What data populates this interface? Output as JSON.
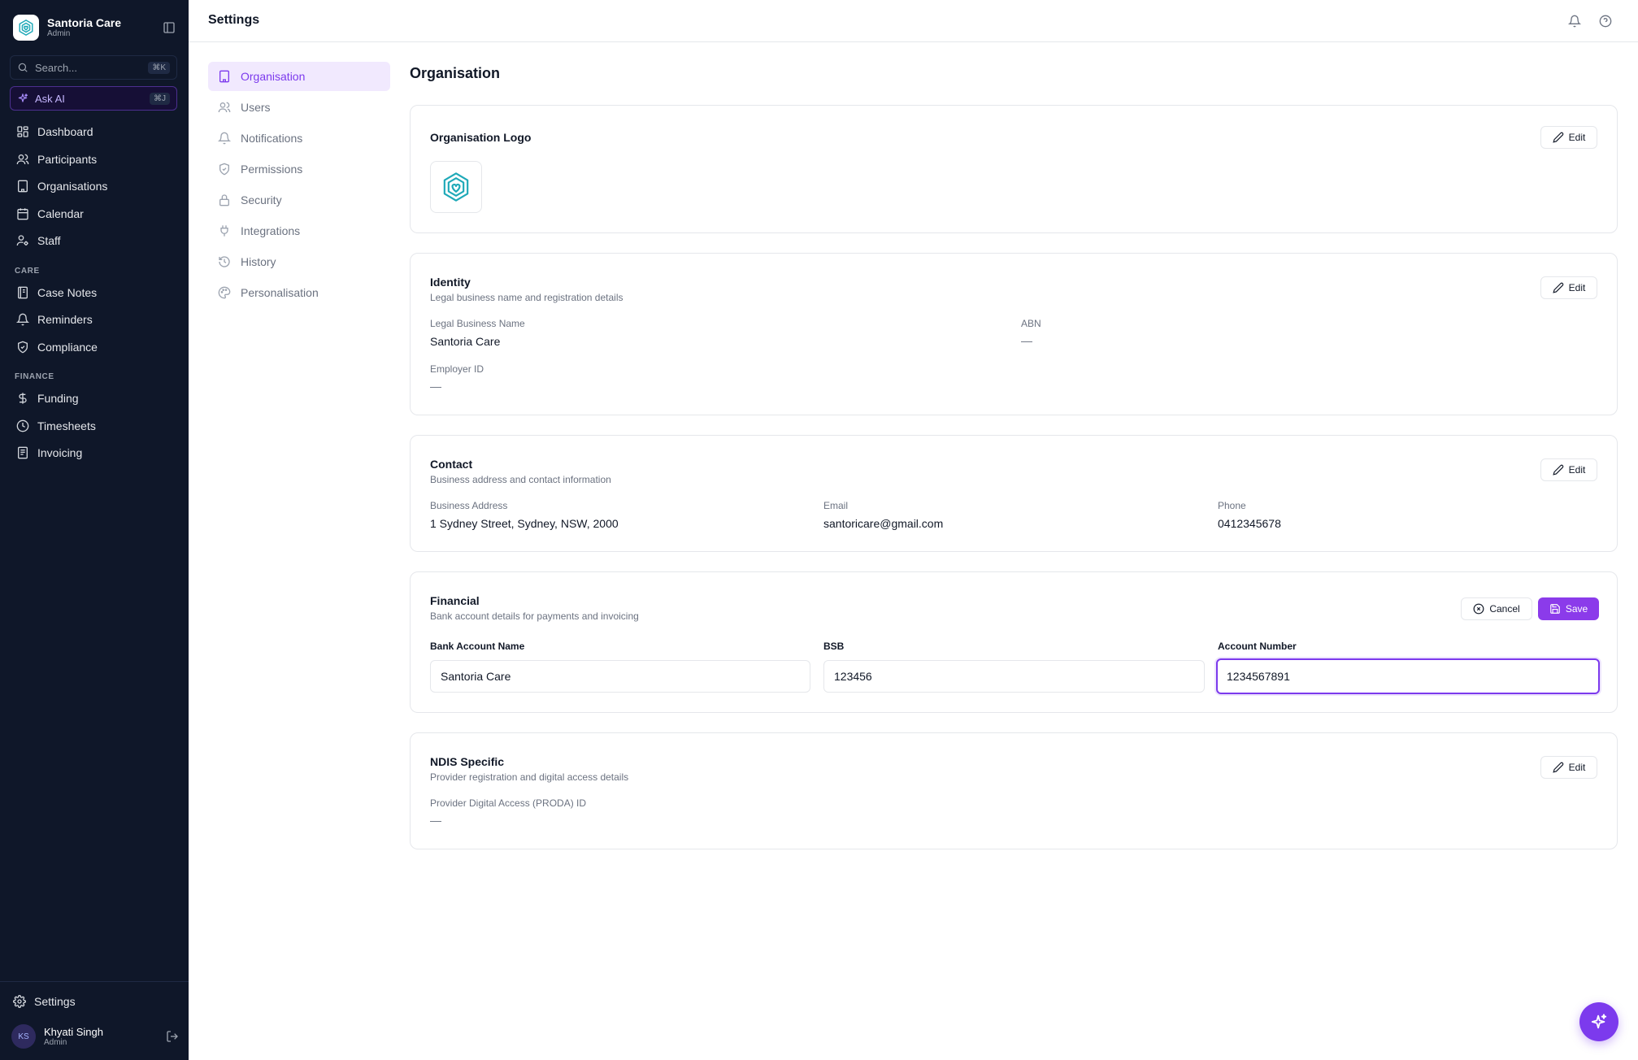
{
  "sidebar": {
    "brand_name": "Santoria Care",
    "brand_role": "Admin",
    "search_placeholder": "Search...",
    "search_shortcut": "⌘K",
    "ask_ai_label": "Ask AI",
    "ask_ai_shortcut": "⌘J",
    "main_items": [
      {
        "label": "Dashboard",
        "icon": "layout-grid-icon"
      },
      {
        "label": "Participants",
        "icon": "users-icon"
      },
      {
        "label": "Organisations",
        "icon": "building-icon"
      },
      {
        "label": "Calendar",
        "icon": "calendar-icon"
      },
      {
        "label": "Staff",
        "icon": "user-cog-icon"
      }
    ],
    "care_section": "CARE",
    "care_items": [
      {
        "label": "Case Notes",
        "icon": "notebook-icon"
      },
      {
        "label": "Reminders",
        "icon": "bell-icon"
      },
      {
        "label": "Compliance",
        "icon": "shield-check-icon"
      }
    ],
    "finance_section": "FINANCE",
    "finance_items": [
      {
        "label": "Funding",
        "icon": "dollar-icon"
      },
      {
        "label": "Timesheets",
        "icon": "clock-icon"
      },
      {
        "label": "Invoicing",
        "icon": "receipt-icon"
      }
    ],
    "settings_label": "Settings",
    "user": {
      "initials": "KS",
      "name": "Khyati Singh",
      "role": "Admin"
    }
  },
  "header": {
    "title": "Settings"
  },
  "settings_nav": {
    "items": [
      {
        "label": "Organisation",
        "icon": "building-icon",
        "active": true
      },
      {
        "label": "Users",
        "icon": "users-icon"
      },
      {
        "label": "Notifications",
        "icon": "bell-icon"
      },
      {
        "label": "Permissions",
        "icon": "shield-check-icon"
      },
      {
        "label": "Security",
        "icon": "lock-icon"
      },
      {
        "label": "Integrations",
        "icon": "plug-icon"
      },
      {
        "label": "History",
        "icon": "history-icon"
      },
      {
        "label": "Personalisation",
        "icon": "palette-icon"
      }
    ]
  },
  "main": {
    "title": "Organisation",
    "edit_label": "Edit",
    "logo_card": {
      "title": "Organisation Logo"
    },
    "identity": {
      "title": "Identity",
      "subtitle": "Legal business name and registration details",
      "legal_name_label": "Legal Business Name",
      "legal_name_value": "Santoria Care",
      "abn_label": "ABN",
      "abn_value": "—",
      "employer_id_label": "Employer ID",
      "employer_id_value": "—"
    },
    "contact": {
      "title": "Contact",
      "subtitle": "Business address and contact information",
      "address_label": "Business Address",
      "address_value": "1 Sydney Street, Sydney, NSW, 2000",
      "email_label": "Email",
      "email_value": "santoricare@gmail.com",
      "phone_label": "Phone",
      "phone_value": "0412345678"
    },
    "financial": {
      "title": "Financial",
      "subtitle": "Bank account details for payments and invoicing",
      "cancel_label": "Cancel",
      "save_label": "Save",
      "bank_name_label": "Bank Account Name",
      "bank_name_value": "Santoria Care",
      "bsb_label": "BSB",
      "bsb_value": "123456",
      "account_number_label": "Account Number",
      "account_number_value": "1234567891"
    },
    "ndis": {
      "title": "NDIS Specific",
      "subtitle": "Provider registration and digital access details",
      "proda_label": "Provider Digital Access (PRODA) ID",
      "proda_value": "—"
    }
  },
  "colors": {
    "sidebar_bg": "#0f1729",
    "accent": "#7c3aed",
    "active_nav_bg": "#f1e9fe",
    "logo_teal": "#1fa9b8"
  }
}
